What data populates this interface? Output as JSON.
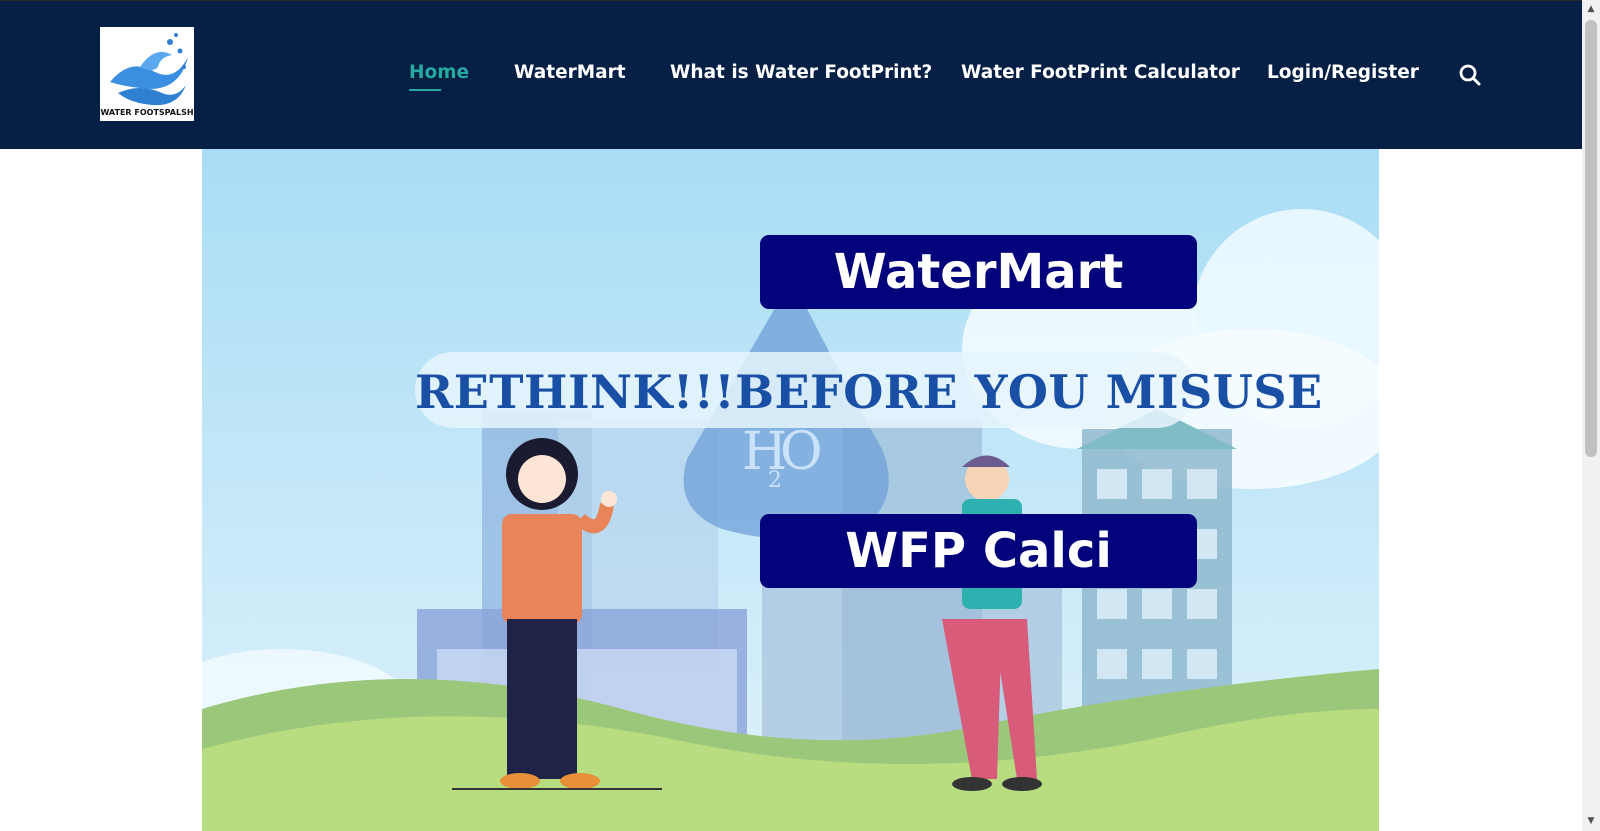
{
  "logo": {
    "text": "WATER FOOTSPALSH",
    "icon": "water-splash-logo"
  },
  "nav": {
    "items": [
      {
        "label": "Home",
        "active": true
      },
      {
        "label": "WaterMart",
        "active": false
      },
      {
        "label": "What is Water FootPrint?",
        "active": false
      },
      {
        "label": "Water FootPrint Calculator",
        "active": false
      },
      {
        "label": "Login/Register",
        "active": false
      }
    ],
    "search_icon": "search-icon"
  },
  "hero": {
    "tagline": "RETHINK!!!BEFORE YOU MISUSE",
    "watermart_button": "WaterMart",
    "calc_button": "WFP Calci",
    "drop_label": "H2O"
  },
  "colors": {
    "navbar_bg": "#061f44",
    "active_link": "#27a8a0",
    "button_bg": "#03047b",
    "tagline": "#1950a6"
  }
}
